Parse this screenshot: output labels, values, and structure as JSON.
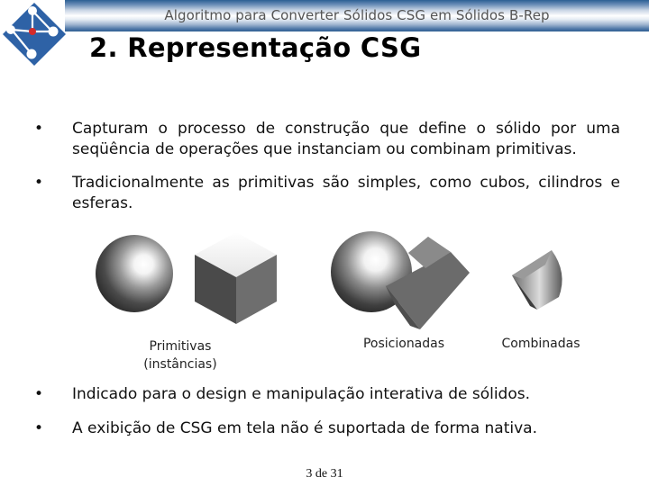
{
  "header": {
    "title": "Algoritmo para Converter Sólidos CSG em Sólidos B-Rep",
    "logo_icon": "network-diamond-logo-icon"
  },
  "slide": {
    "title": "2. Representação CSG",
    "bullets_top": [
      {
        "icon": "bullet-dot",
        "text": "Capturam o processo de construção que define o sólido por uma seqüência de operações que instanciam ou combinam primitivas."
      },
      {
        "icon": "bullet-dot",
        "text": "Tradicionalmente as primitivas são simples, como cubos, cilindros e esferas."
      }
    ],
    "figure": {
      "captions": {
        "primitives": "Primitivas (instâncias)",
        "primitives_line1": "Primitivas",
        "primitives_line2": "(instâncias)",
        "positioned": "Posicionadas",
        "combined": "Combinadas"
      },
      "images": [
        "sphere",
        "cube",
        "sphere-and-cube-positioned",
        "combined-intersection-solid"
      ]
    },
    "bullets_bottom": [
      {
        "icon": "bullet-dot",
        "text": "Indicado para o design e manipulação interativa de sólidos."
      },
      {
        "icon": "bullet-dot",
        "text": "A exibição de CSG em tela não é suportada de forma nativa."
      }
    ],
    "bullet_char": "•"
  },
  "footer": {
    "page_number": "3 de 31"
  },
  "colors": {
    "brand_blue": "#2c5f94",
    "logo_blue": "#2e62a6",
    "logo_red": "#d42a2a"
  }
}
